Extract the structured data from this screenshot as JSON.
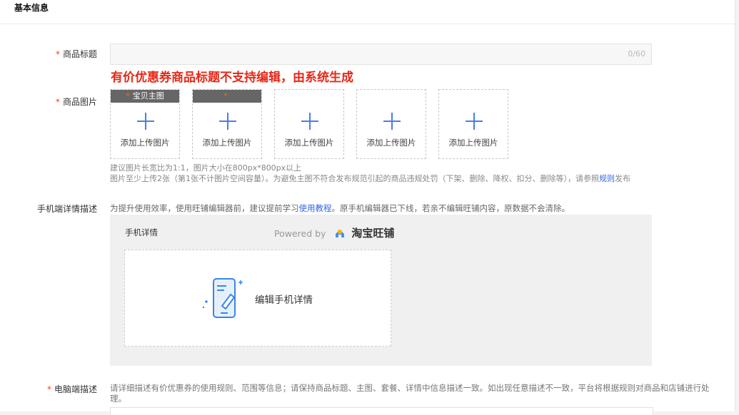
{
  "section": {
    "title": "基本信息"
  },
  "title_field": {
    "label": "商品标题",
    "required_mark": "*",
    "counter": "0/60",
    "note": "有价优惠券商品标题不支持编辑，由系统生成"
  },
  "image_field": {
    "label": "商品图片",
    "required_mark": "*",
    "slots": [
      {
        "tag_star": "*",
        "tag_text": "宝贝主图",
        "upload_text": "添加上传图片"
      },
      {
        "tag_star": "*",
        "tag_text": "",
        "upload_text": "添加上传图片"
      },
      {
        "upload_text": "添加上传图片"
      },
      {
        "upload_text": "添加上传图片"
      },
      {
        "upload_text": "添加上传图片"
      }
    ],
    "hint_line1": "建议图片长宽比为1:1，图片大小在800px*800px以上",
    "hint_line2_pre": "图片至少上传2张（第1张不计图片空间容量）。为避免主图不符合发布规范引起的商品违规处罚（下架、删除、降权、扣分、删除等），请参照",
    "hint_line2_link": "规则",
    "hint_line2_post": "发布"
  },
  "mobile_desc": {
    "label": "手机端详情描述",
    "text_pre": "为提升使用效率，使用旺铺编辑器前，建议提前学习",
    "text_link": "使用教程",
    "text_post": "。原手机编辑器已下线，若亲不编辑旺铺内容，原数据不会清除。",
    "editor_label": "手机详情",
    "powered_by": "Powered by",
    "brand": "淘宝旺铺",
    "edit_button": "编辑手机详情"
  },
  "pc_desc": {
    "label": "电脑端描述",
    "required_mark": "*",
    "text": "请详细描述有价优惠券的使用规则、范围等信息；请保持商品标题、主图、套餐、详情中信息描述一致。如出现任意描述不一致，平台将根据规则对商品和店铺进行处理。"
  },
  "colors": {
    "accent": "#4a7ee6",
    "required": "#ff3f00",
    "note_red": "#e62817",
    "link": "#3366e0"
  }
}
